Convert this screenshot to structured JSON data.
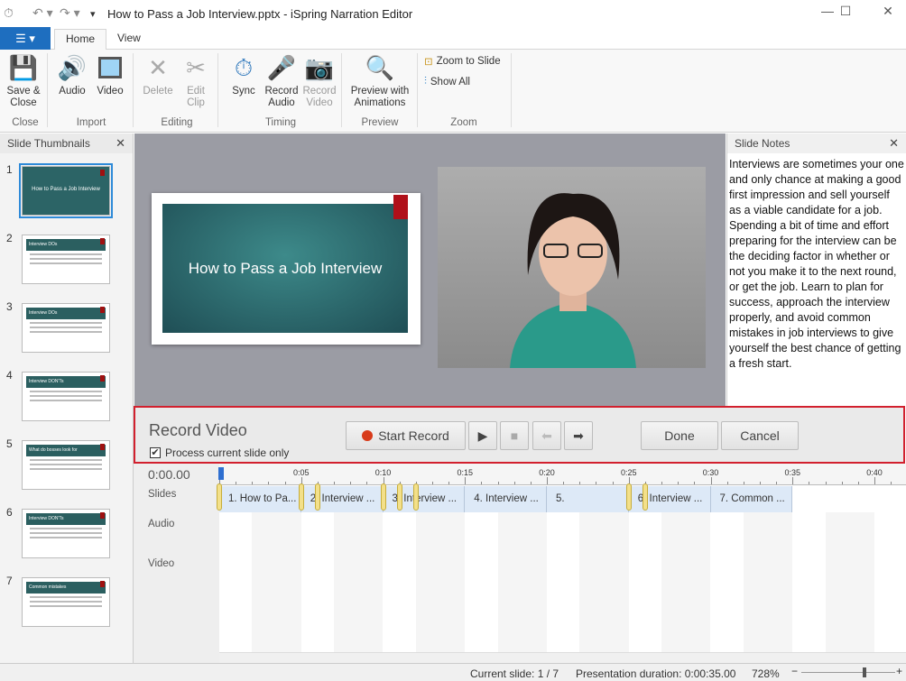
{
  "window": {
    "title": "How to Pass a Job Interview.pptx - iSpring Narration Editor"
  },
  "tabs": [
    {
      "label": "Home",
      "active": true
    },
    {
      "label": "View",
      "active": false
    }
  ],
  "ribbon": {
    "groups": [
      {
        "label": "Close"
      },
      {
        "label": "Import"
      },
      {
        "label": "Editing"
      },
      {
        "label": "Timing"
      },
      {
        "label": "Preview"
      },
      {
        "label": "Zoom"
      }
    ],
    "buttons": {
      "save_close": "Save &\nClose",
      "audio": "Audio",
      "video": "Video",
      "delete": "Delete",
      "edit_clip": "Edit\nClip",
      "sync": "Sync",
      "record_audio": "Record\nAudio",
      "record_video": "Record\nVideo",
      "preview": "Preview with\nAnimations",
      "zoom_to_slide": "Zoom to Slide",
      "show_all": "Show All"
    }
  },
  "thumbnails": {
    "title": "Slide Thumbnails",
    "items": [
      {
        "number": "1",
        "title": "How to Pass a Job Interview",
        "selected": true
      },
      {
        "number": "2",
        "title": "Interview DOs"
      },
      {
        "number": "3",
        "title": "Interview DOs"
      },
      {
        "number": "4",
        "title": "Interview DON'Ts"
      },
      {
        "number": "5",
        "title": "What do bosses look for"
      },
      {
        "number": "6",
        "title": "Interview DON'Ts"
      },
      {
        "number": "7",
        "title": "Common mistakes"
      }
    ]
  },
  "slide": {
    "title": "How to Pass a Job Interview"
  },
  "notes": {
    "title": "Slide Notes",
    "text": "Interviews are sometimes your one and only chance at making a good first impression and sell yourself as a viable candidate for a job. Spending a bit of time and effort preparing for the interview can be the deciding factor in whether or not you make it to the next round, or get the job. Learn to plan for success, approach the interview properly, and avoid common mistakes in job interviews to give yourself the best chance of getting a fresh start."
  },
  "record": {
    "title": "Record Video",
    "checkbox_label": "Process current slide only",
    "checked": true,
    "start": "Start Record",
    "done": "Done",
    "cancel": "Cancel",
    "record_color": "#d83b1a"
  },
  "timeline": {
    "time": "0:00.00",
    "rows": [
      "Slides",
      "Audio",
      "Video"
    ],
    "ticks": [
      "0:05",
      "0:10",
      "0:15",
      "0:20",
      "0:25",
      "0:30",
      "0:35",
      "0:40"
    ],
    "segments": [
      {
        "label": "1. How to Pa...",
        "start": 0,
        "end": 5
      },
      {
        "label": "2. Interview ...",
        "start": 5,
        "end": 10
      },
      {
        "label": "3. Interview ...",
        "start": 10,
        "end": 15
      },
      {
        "label": "4. Interview ...",
        "start": 15,
        "end": 20
      },
      {
        "label": "5.",
        "start": 20,
        "end": 25
      },
      {
        "label": "6. Interview ...",
        "start": 25,
        "end": 30
      },
      {
        "label": "7. Common ...",
        "start": 30,
        "end": 35
      }
    ],
    "markers": [
      0,
      5,
      6,
      10,
      11,
      12,
      25,
      26
    ]
  },
  "status": {
    "current_slide": "Current slide: 1 / 7",
    "duration": "Presentation duration: 0:00:35.00",
    "zoom": "728%"
  }
}
